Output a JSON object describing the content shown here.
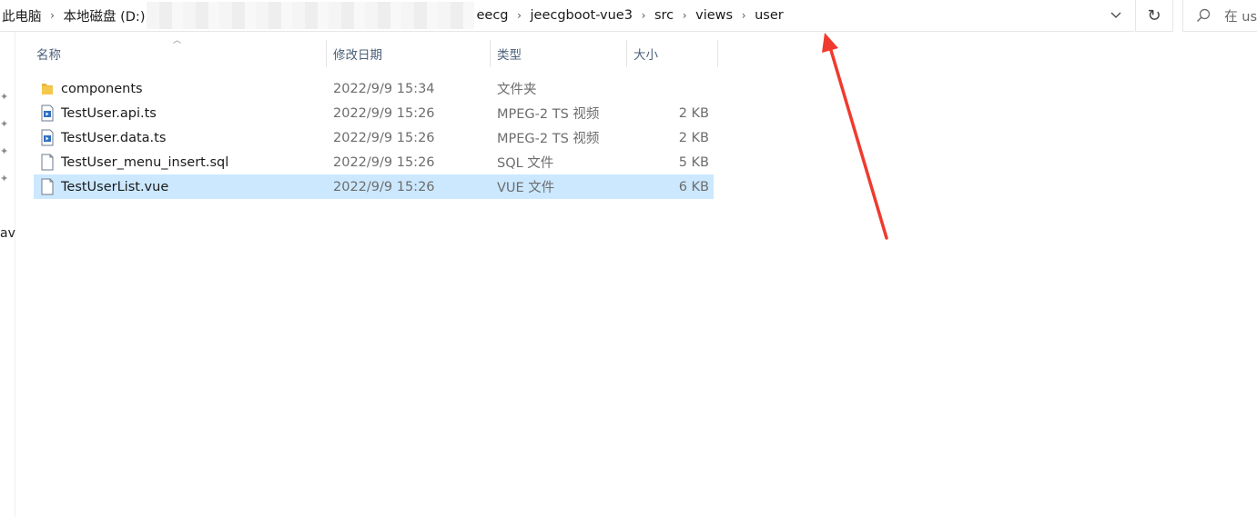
{
  "address_bar": {
    "crumbs": [
      "此电脑",
      "本地磁盘 (D:)",
      "eecg",
      "jeecgboot-vue3",
      "src",
      "views",
      "user"
    ],
    "separator": "›",
    "dropdown_icon": "chevron-down-icon",
    "refresh_icon": "refresh-icon",
    "refresh_glyph": "↻"
  },
  "search": {
    "placeholder": "在 us",
    "icon": "search-icon"
  },
  "nav_strip": {
    "partial_label": "av",
    "pin_icon": "pin-icon"
  },
  "columns": {
    "name": "名称",
    "date": "修改日期",
    "type": "类型",
    "size": "大小"
  },
  "files": [
    {
      "name": "components",
      "date": "2022/9/9 15:34",
      "type": "文件夹",
      "size": "",
      "icon": "folder-icon"
    },
    {
      "name": "TestUser.api.ts",
      "date": "2022/9/9 15:26",
      "type": "MPEG-2 TS 视频",
      "size": "2 KB",
      "icon": "ts-file-icon"
    },
    {
      "name": "TestUser.data.ts",
      "date": "2022/9/9 15:26",
      "type": "MPEG-2 TS 视频",
      "size": "2 KB",
      "icon": "ts-file-icon"
    },
    {
      "name": "TestUser_menu_insert.sql",
      "date": "2022/9/9 15:26",
      "type": "SQL 文件",
      "size": "5 KB",
      "icon": "file-icon"
    },
    {
      "name": "TestUserList.vue",
      "date": "2022/9/9 15:26",
      "type": "VUE 文件",
      "size": "6 KB",
      "icon": "file-icon",
      "selected": true
    }
  ],
  "colors": {
    "selection": "#cce8ff",
    "header_text": "#4c607a",
    "annotation_arrow": "#f03a2e",
    "folder": "#e8b73f"
  }
}
